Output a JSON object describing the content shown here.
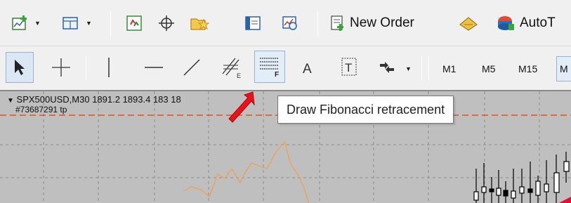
{
  "toolbar_top": {
    "new_order_label": "New Order",
    "autotrading_label": "AutoT"
  },
  "toolbar_draw": {
    "timeframes": [
      "M1",
      "M5",
      "M15",
      "M"
    ]
  },
  "chart": {
    "info_text": "SPX500USD,M30  1891.2 1893.4 18",
    "info_text_tail": "3 18",
    "order_label": "#73687291 tp",
    "background_color": "#bfbfbf",
    "line_color": "#f0a050",
    "tp_line_color": "#e8501a"
  },
  "tooltip": {
    "text": "Draw Fibonacci retracement"
  },
  "icons": [
    "new-chart-icon",
    "profiles-icon",
    "market-watch-icon",
    "crosshair-icon",
    "navigator-icon",
    "terminal-icon",
    "strategy-tester-icon",
    "new-order-icon",
    "metaeditor-icon",
    "autotrading-icon",
    "cursor-icon",
    "crosshair-tool-icon",
    "vertical-line-icon",
    "horizontal-line-icon",
    "trendline-icon",
    "equidistant-channel-icon",
    "fibonacci-icon",
    "text-icon",
    "text-label-icon",
    "arrows-icon",
    "red-arrow-icon"
  ]
}
